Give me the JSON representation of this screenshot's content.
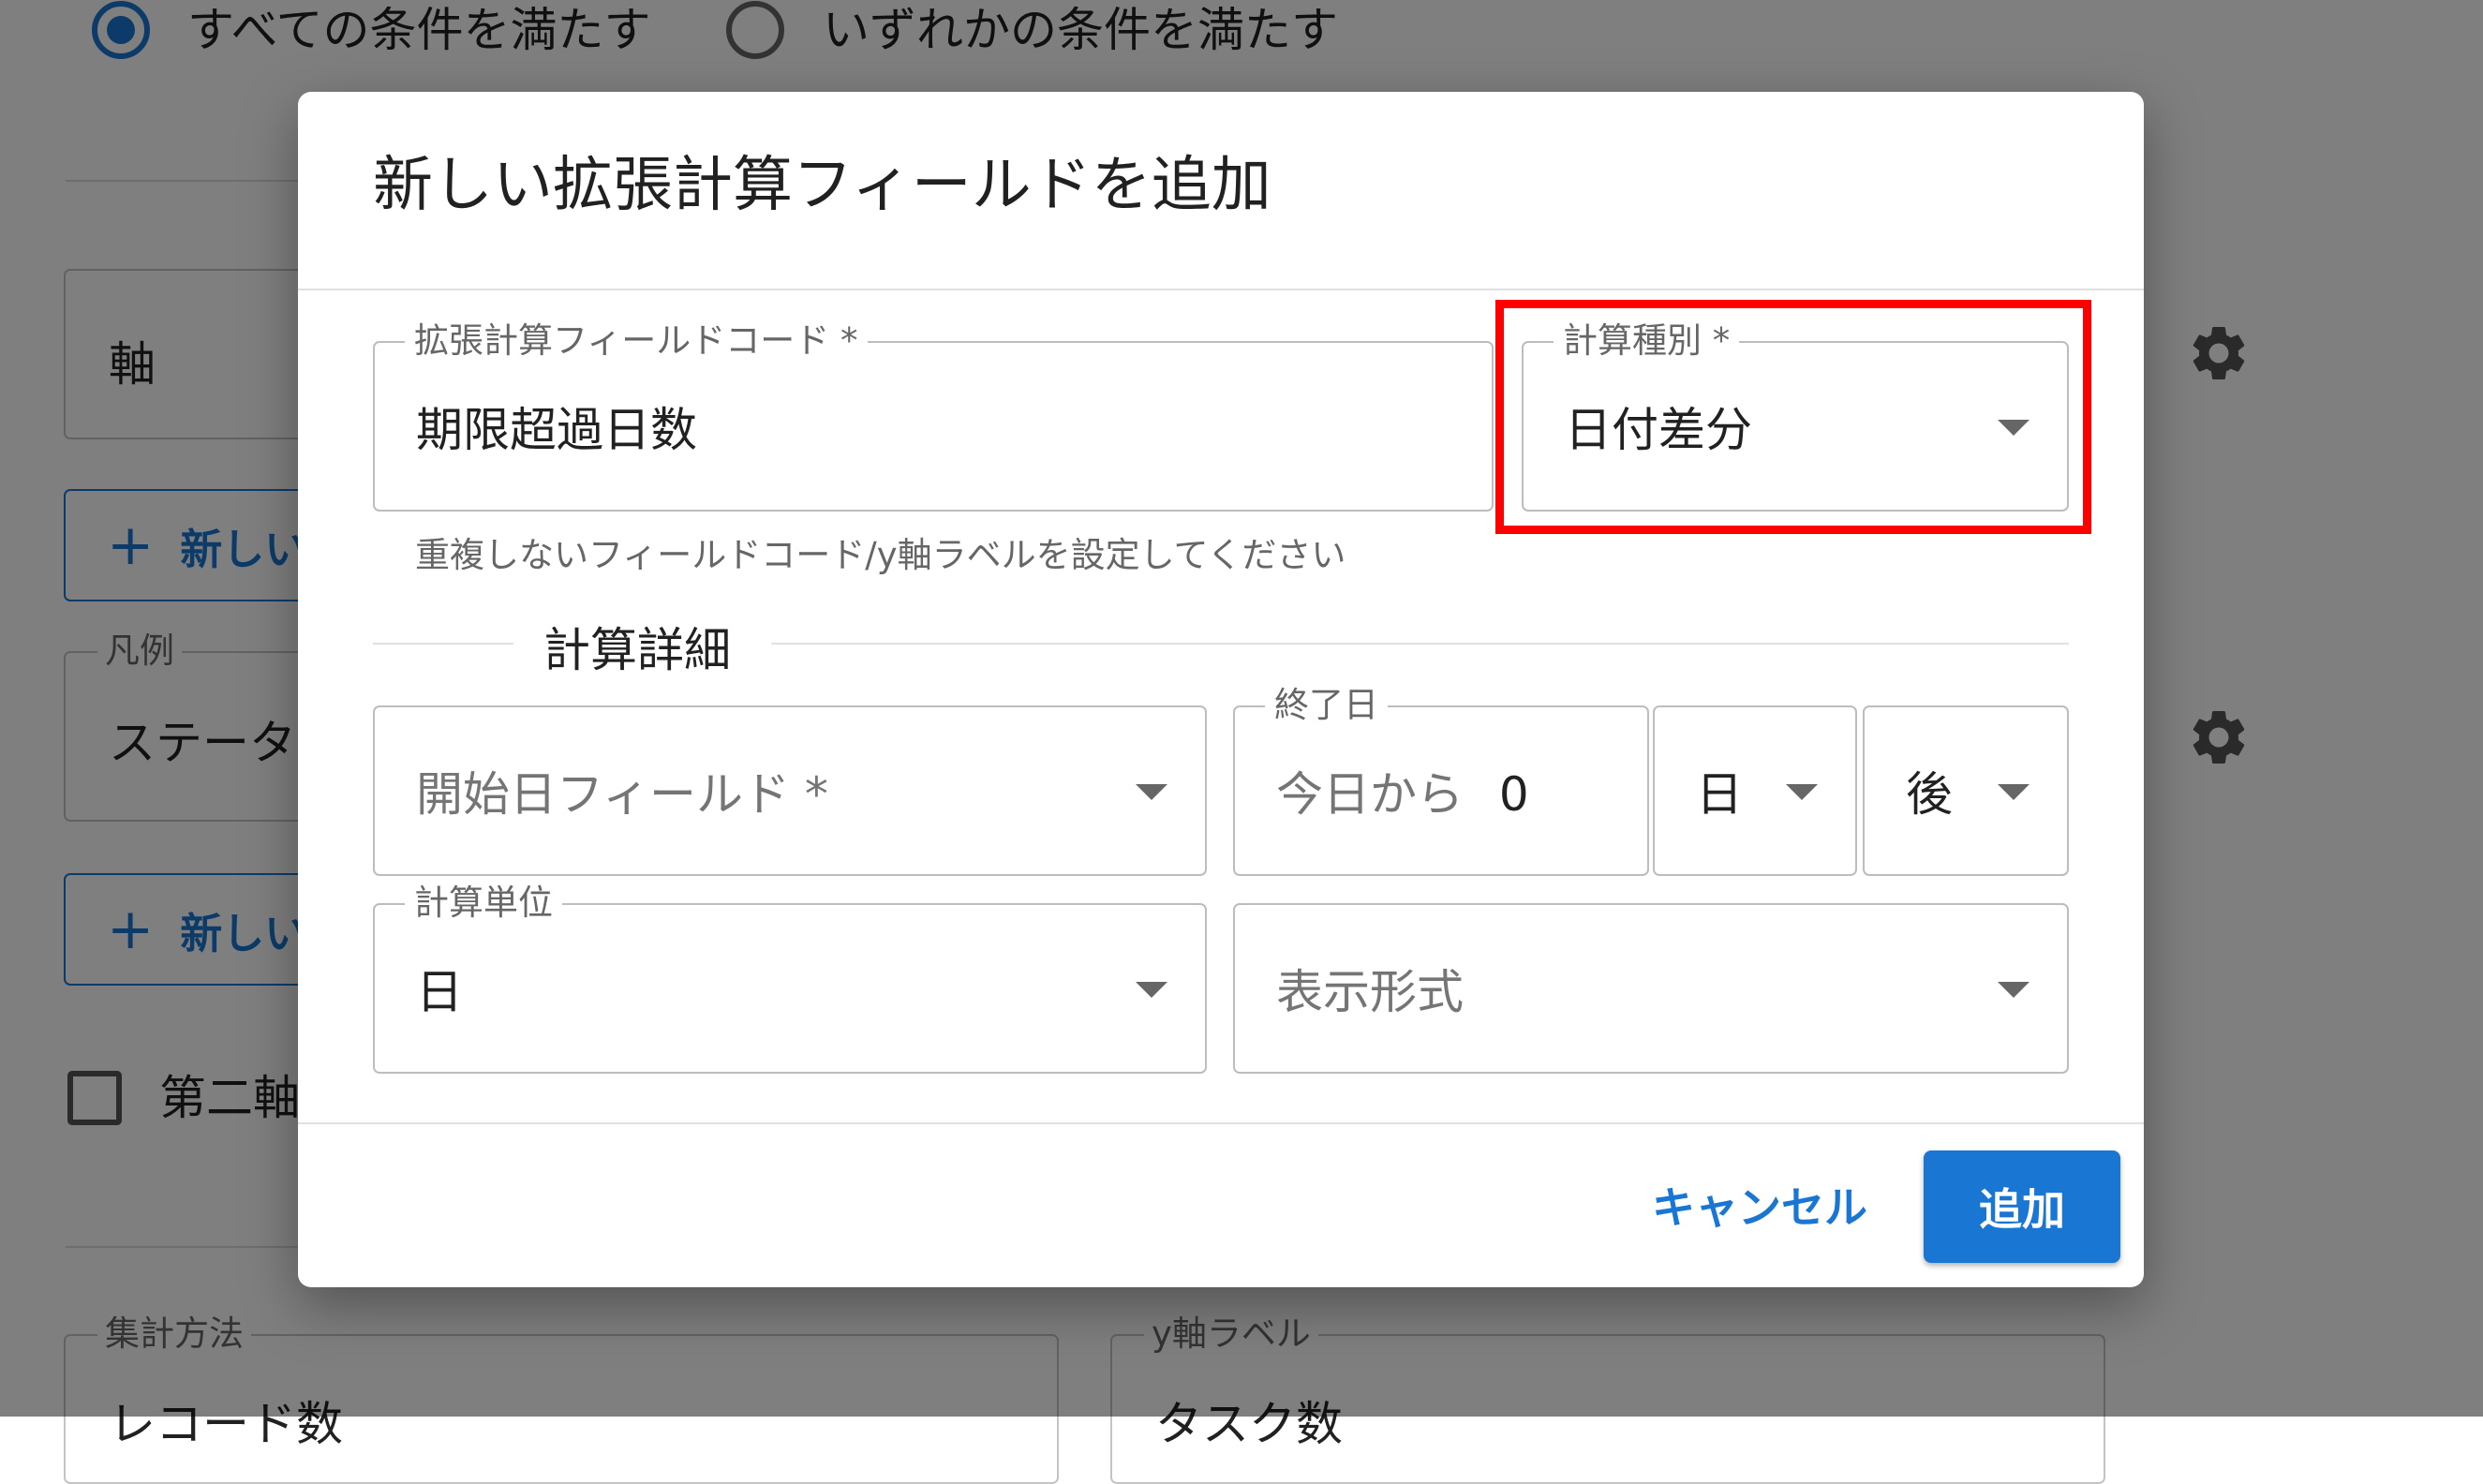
{
  "background": {
    "radio_all": "すべての条件を満たす",
    "radio_any": "いずれかの条件を満たす",
    "axis_field": "軸",
    "add_axis_button": "新しい",
    "legend_label": "凡例",
    "legend_value": "ステータ",
    "add_legend_button": "新しい",
    "secondary_axis_label": "第二軸",
    "aggregation_label": "集計方法",
    "aggregation_value": "レコード数",
    "y_axis_label_label": "y軸ラベル",
    "y_axis_label_value": "タスク数"
  },
  "dialog": {
    "title": "新しい拡張計算フィールドを追加",
    "field_code": {
      "label": "拡張計算フィールドコード *",
      "value": "期限超過日数",
      "helper": "重複しないフィールドコード/y軸ラベルを設定してください"
    },
    "calc_type": {
      "label": "計算種別 *",
      "value": "日付差分"
    },
    "details_title": "計算詳細",
    "start_date": {
      "placeholder": "開始日フィールド *"
    },
    "end_date": {
      "label": "終了日",
      "value_prefix": "今日から",
      "value_number": "0",
      "unit": "日",
      "direction": "後"
    },
    "calc_unit": {
      "label": "計算単位",
      "value": "日"
    },
    "display_format": {
      "placeholder": "表示形式"
    },
    "cancel_label": "キャンセル",
    "add_label": "追加"
  },
  "colors": {
    "primary": "#1976d2",
    "highlight": "#ff0000",
    "overlay": "rgba(0,0,0,0.5)"
  },
  "icons": {
    "radio_checked": "radio-checked-icon",
    "radio_unchecked": "radio-unchecked-icon",
    "settings": "gear-icon",
    "dropdown": "caret-down-icon",
    "checkbox": "checkbox-unchecked-icon"
  }
}
